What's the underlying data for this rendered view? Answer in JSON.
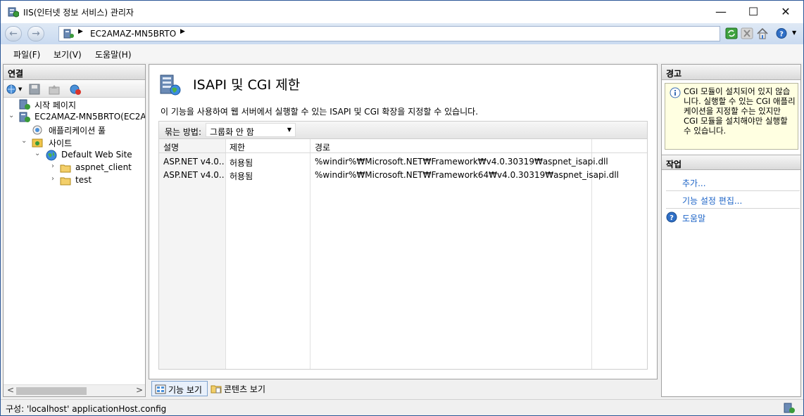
{
  "window": {
    "title": "IIS(인터넷 정보 서비스) 관리자",
    "controls": {
      "minimize": "—",
      "maximize": "☐",
      "close": "✕"
    }
  },
  "address": {
    "back": "←",
    "forward": "→",
    "server": "EC2AMAZ-MN5BRTO",
    "separator": "▶"
  },
  "menu": {
    "file": "파일(F)",
    "view": "보기(V)",
    "help": "도움말(H)"
  },
  "connections": {
    "header": "연결",
    "tree": {
      "start_page": "시작 페이지",
      "server": "EC2AMAZ-MN5BRTO(EC2AM",
      "app_pools": "애플리케이션 풀",
      "sites": "사이트",
      "default_site": "Default Web Site",
      "aspnet_client": "aspnet_client",
      "test": "test"
    },
    "scroll_left": "<",
    "scroll_right": ">"
  },
  "main": {
    "title": "ISAPI 및 CGI 제한",
    "description": "이 기능을 사용하여 웹 서버에서 실행할 수 있는 ISAPI 및 CGI 확장을 지정할 수 있습니다.",
    "group_label": "묶는 방법:",
    "group_value": "그룹화 안 함",
    "columns": [
      "설명",
      "제한",
      "경로"
    ],
    "rows": [
      {
        "desc": "ASP.NET v4.0...",
        "restriction": "허용됨",
        "path": "%windir%₩Microsoft.NET₩Framework₩v4.0.30319₩aspnet_isapi.dll"
      },
      {
        "desc": "ASP.NET v4.0...",
        "restriction": "허용됨",
        "path": "%windir%₩Microsoft.NET₩Framework64₩v4.0.30319₩aspnet_isapi.dll"
      }
    ],
    "view_tabs": {
      "features": "기능 보기",
      "content": "콘텐츠 보기"
    }
  },
  "alerts": {
    "header": "경고",
    "message": "CGI 모듈이 설치되어 있지 않습니다. 실행할 수 있는 CGI 애플리케이션을 지정할 수는 있지만 CGI 모듈을 설치해야만 실행할 수 있습니다."
  },
  "actions": {
    "header": "작업",
    "add": "추가...",
    "edit_settings": "기능 설정 편집...",
    "help": "도움말"
  },
  "status": {
    "text": "구성: 'localhost' applicationHost.config"
  }
}
